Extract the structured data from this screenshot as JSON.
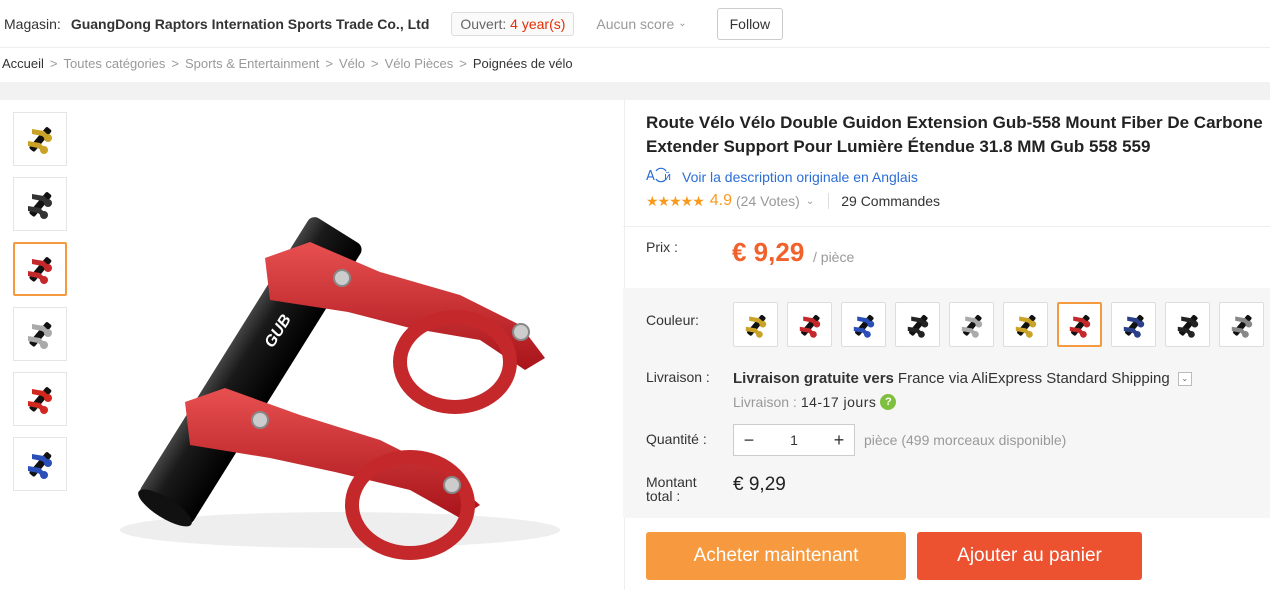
{
  "store": {
    "label": "Magasin:",
    "name": "GuangDong Raptors Internation Sports Trade Co., Ltd",
    "open_prefix": "Ouvert:",
    "open_years": "4 year(s)",
    "score": "Aucun score",
    "follow_label": "Follow"
  },
  "breadcrumb": [
    "Accueil",
    "Toutes catégories",
    "Sports & Entertainment",
    "Vélo",
    "Vélo Pièces",
    "Poignées de vélo"
  ],
  "gallery": {
    "thumbnail_colors": [
      "#c9a227",
      "#333333",
      "#c4282b",
      "#aaaaaa",
      "#d0271f",
      "#2b4fb8"
    ],
    "active_index": 2,
    "main_color": "#c4282b"
  },
  "product": {
    "title": "Route Vélo Vélo Double Guidon Extension Gub-558 Mount Fiber De Carbone Extender Support Pour Lumière Étendue 31.8 MM Gub 558 559",
    "original_desc_link": "Voir la description originale en Anglais",
    "stars": "★★★★★",
    "rating": "4.9",
    "votes": "(24 Votes)",
    "orders": "29 Commandes"
  },
  "price": {
    "label": "Prix :",
    "value": "€ 9,29",
    "unit": "/ pièce"
  },
  "color": {
    "label": "Couleur:",
    "swatches": [
      "#c9a227",
      "#c4282b",
      "#2b4fb8",
      "#222222",
      "#aaaaaa",
      "#c9a227",
      "#c4282b",
      "#2b3f8a",
      "#222222",
      "#888888"
    ],
    "active_index": 6
  },
  "shipping": {
    "label": "Livraison :",
    "free_text": "Livraison gratuite vers",
    "destination": "France via AliExpress Standard Shipping",
    "time_label": "Livraison :",
    "time_value": "14-17 jours",
    "help_icon": "?"
  },
  "quantity": {
    "label": "Quantité :",
    "minus": "−",
    "value": "1",
    "plus": "+",
    "availability": "pièce (499 morceaux disponible)"
  },
  "total": {
    "label": "Montant total :",
    "value": "€ 9,29"
  },
  "actions": {
    "buy_now": "Acheter maintenant",
    "add_to_cart": "Ajouter au panier"
  }
}
